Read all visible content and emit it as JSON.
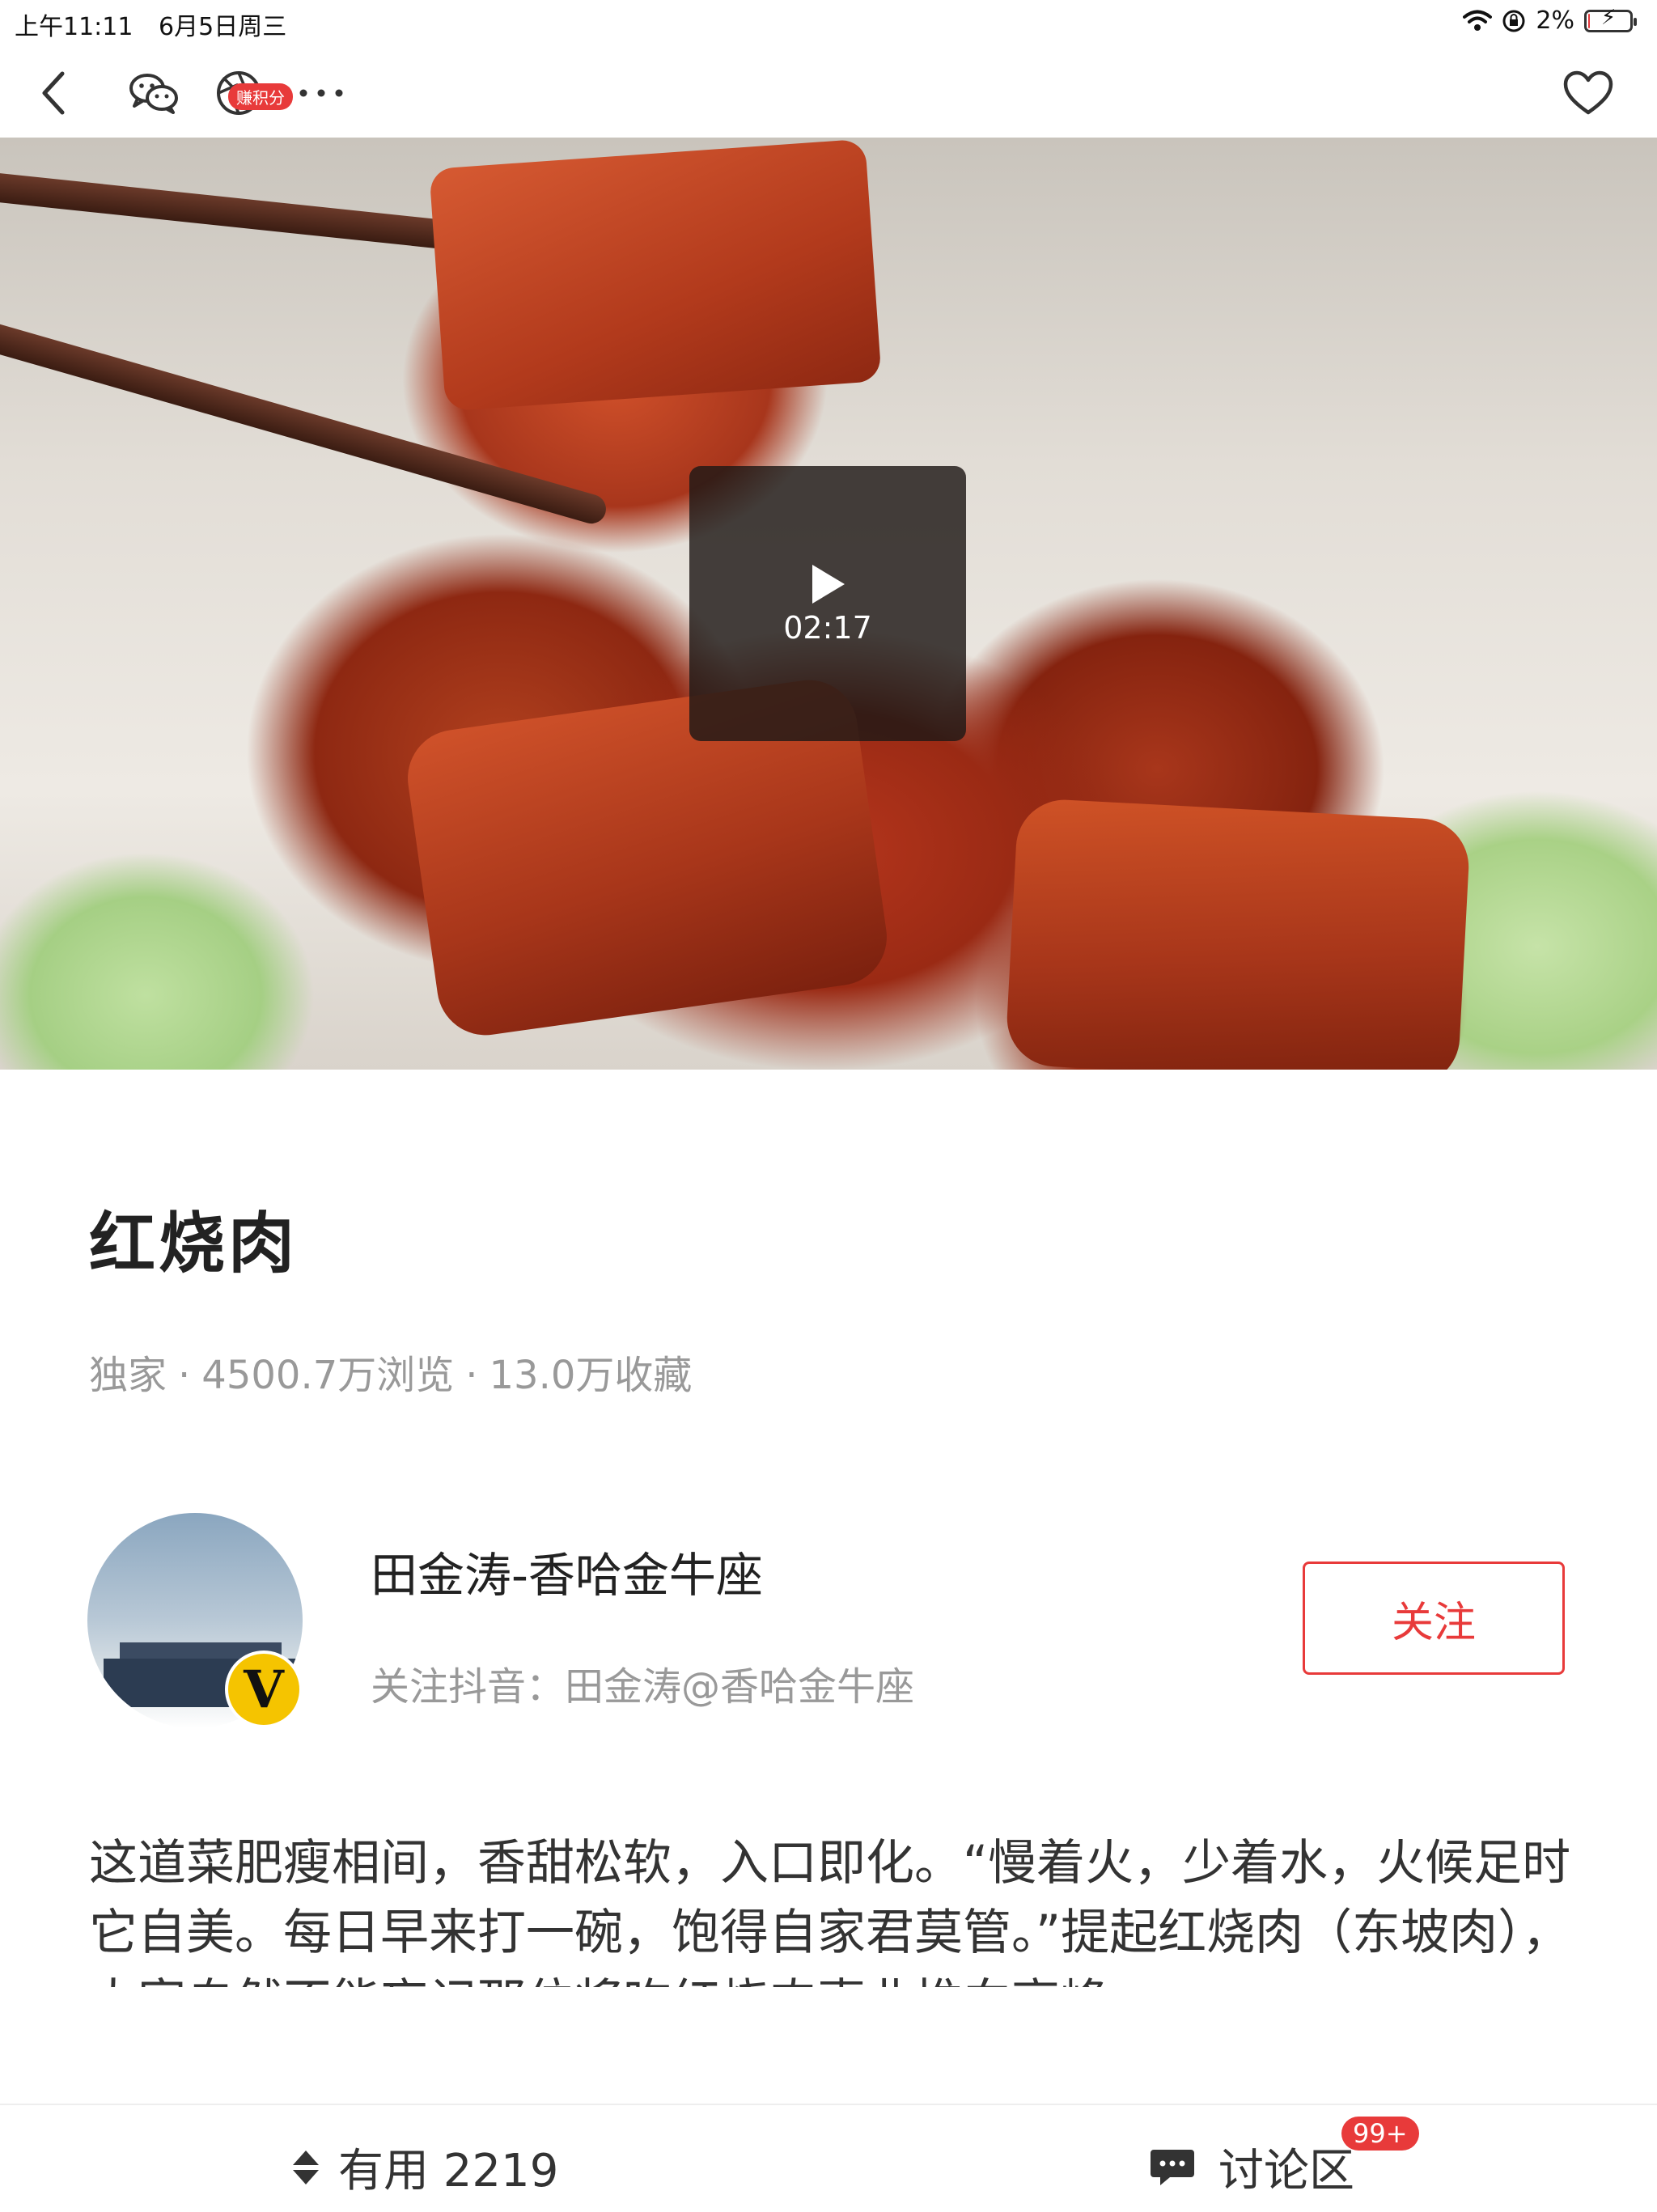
{
  "status_bar": {
    "time": "上午11:11",
    "date": "6月5日周三",
    "battery": "2%",
    "battery_level": 0.02
  },
  "nav": {
    "earn_badge": "赚积分"
  },
  "video": {
    "duration": "02:17"
  },
  "recipe": {
    "title": "红烧肉",
    "meta": {
      "tag": "独家",
      "dot": "·",
      "views": "4500.7万浏览",
      "favorites": "13.0万收藏"
    }
  },
  "author": {
    "name": "田金涛-香哈金牛座",
    "subtitle": "关注抖音：田金涛@香哈金牛座",
    "verified_mark": "V",
    "follow_label": "关注"
  },
  "description": "这道菜肥瘦相间，香甜松软，入口即化。“慢着火，少着水，火候足时它自美。每日早来打一碗，饱得自家君莫管。”提起红烧肉（东坡肉），大家自然不能忘记那位将吃红烧肉事业推向高峰",
  "bottom": {
    "useful_label": "有用 2219",
    "discuss_label": "讨论区",
    "discuss_badge": "99+"
  },
  "colors": {
    "accent": "#e83a3a",
    "verified": "#f5c400"
  },
  "icons": [
    "back-icon",
    "wechat-icon",
    "moments-icon",
    "more-icon",
    "heart-icon",
    "play-icon",
    "vote-icon",
    "comment-icon",
    "wifi-icon",
    "lock-rotation-icon",
    "battery-icon"
  ]
}
